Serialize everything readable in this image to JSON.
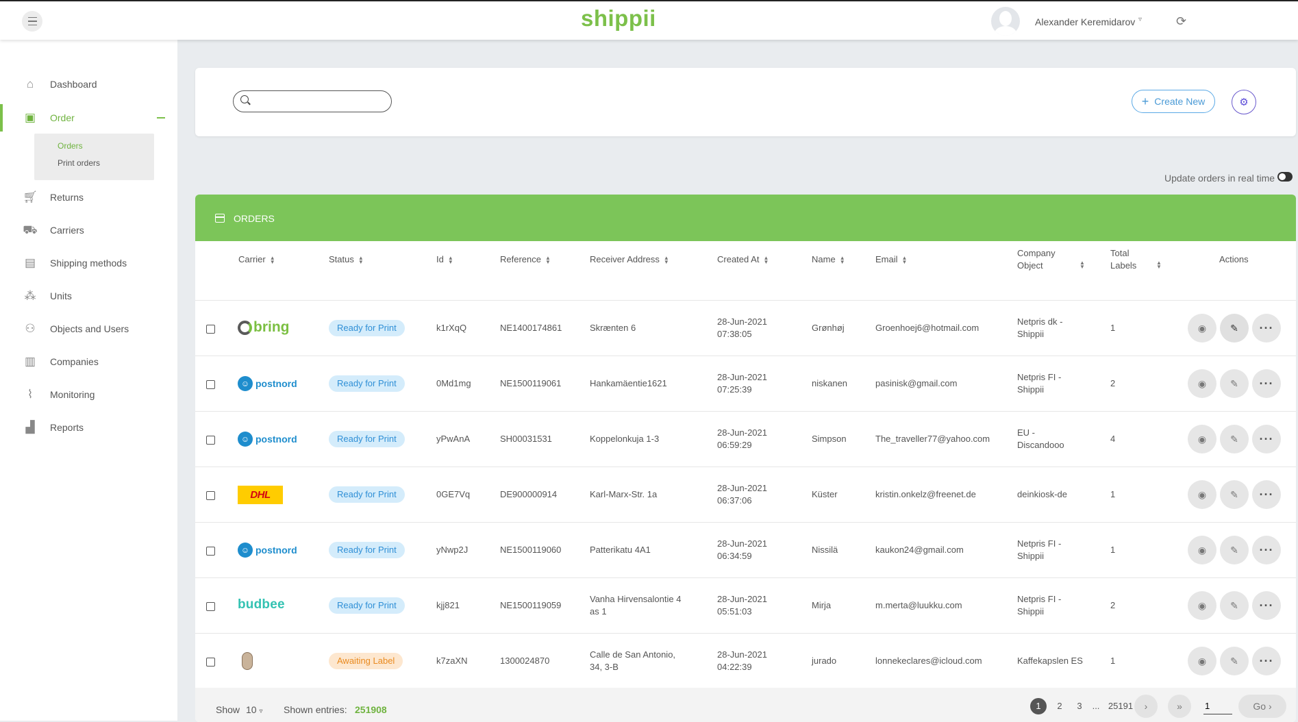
{
  "header": {
    "logo": "shippii",
    "user_name": "Alexander Keremidarov",
    "caret": "▿",
    "refresh_icon": "refresh-icon"
  },
  "sidebar": {
    "items": [
      {
        "label": "Dashboard",
        "icon": "home-icon"
      },
      {
        "label": "Order",
        "icon": "box-icon"
      },
      {
        "label": "Returns",
        "icon": "cart-icon"
      },
      {
        "label": "Carriers",
        "icon": "truck-icon"
      },
      {
        "label": "Shipping methods",
        "icon": "pallet-icon"
      },
      {
        "label": "Units",
        "icon": "network-icon"
      },
      {
        "label": "Objects and Users",
        "icon": "users-icon"
      },
      {
        "label": "Companies",
        "icon": "building-icon"
      },
      {
        "label": "Monitoring",
        "icon": "pulse-icon"
      },
      {
        "label": "Reports",
        "icon": "chart-icon"
      }
    ],
    "submenu": [
      {
        "label": "Orders"
      },
      {
        "label": "Print orders"
      }
    ]
  },
  "toolbar": {
    "search_value": "",
    "create_label": "Create New",
    "realtime_label": "Update orders in real time"
  },
  "orders": {
    "title": "ORDERS",
    "columns": {
      "carrier": "Carrier",
      "status": "Status",
      "id": "Id",
      "reference": "Reference",
      "address": "Receiver Address",
      "created": "Created At",
      "name": "Name",
      "email": "Email",
      "company_1": "Company",
      "company_2": "Object",
      "labels_1": "Total",
      "labels_2": "Labels",
      "actions": "Actions"
    },
    "rows": [
      {
        "carrier": "bring",
        "status": "Ready for Print",
        "id": "k1rXqQ",
        "reference": "NE1400174861",
        "address_1": "Skrænten 6",
        "address_2": "",
        "date": "28-Jun-2021",
        "time": "07:38:05",
        "name": "Grønhøj",
        "email": "Groenhoej6@hotmail.com",
        "company_1": "Netpris dk -",
        "company_2": "Shippii",
        "labels": "1"
      },
      {
        "carrier": "postnord",
        "status": "Ready for Print",
        "id": "0Md1mg",
        "reference": "NE1500119061",
        "address_1": "Hankamäentie1621",
        "address_2": "",
        "date": "28-Jun-2021",
        "time": "07:25:39",
        "name": "niskanen",
        "email": "pasinisk@gmail.com",
        "company_1": "Netpris FI -",
        "company_2": "Shippii",
        "labels": "2"
      },
      {
        "carrier": "postnord",
        "status": "Ready for Print",
        "id": "yPwAnA",
        "reference": "SH00031531",
        "address_1": "Koppelonkuja 1-3",
        "address_2": "",
        "date": "28-Jun-2021",
        "time": "06:59:29",
        "name": "Simpson",
        "email": "The_traveller77@yahoo.com",
        "company_1": "EU -",
        "company_2": "Discandooo",
        "labels": "4"
      },
      {
        "carrier": "DHL",
        "status": "Ready for Print",
        "id": "0GE7Vq",
        "reference": "DE900000914",
        "address_1": "Karl-Marx-Str. 1a",
        "address_2": "",
        "date": "28-Jun-2021",
        "time": "06:37:06",
        "name": "Küster",
        "email": "kristin.onkelz@freenet.de",
        "company_1": "deinkiosk-de",
        "company_2": "",
        "labels": "1"
      },
      {
        "carrier": "postnord",
        "status": "Ready for Print",
        "id": "yNwp2J",
        "reference": "NE1500119060",
        "address_1": "Patterikatu 4A1",
        "address_2": "",
        "date": "28-Jun-2021",
        "time": "06:34:59",
        "name": "Nissilä",
        "email": "kaukon24@gmail.com",
        "company_1": "Netpris FI -",
        "company_2": "Shippii",
        "labels": "1"
      },
      {
        "carrier": "budbee",
        "status": "Ready for Print",
        "id": "kjj821",
        "reference": "NE1500119059",
        "address_1": "Vanha Hirvensalontie 4",
        "address_2": "as 1",
        "date": "28-Jun-2021",
        "time": "05:51:03",
        "name": "Mirja",
        "email": "m.merta@luukku.com",
        "company_1": "Netpris FI -",
        "company_2": "Shippii",
        "labels": "2"
      },
      {
        "carrier": "kaffekapslen",
        "status": "Awaiting Label",
        "id": "k7zaXN",
        "reference": "1300024870",
        "address_1": "Calle de San Antonio,",
        "address_2": "34, 3-B",
        "date": "28-Jun-2021",
        "time": "04:22:39",
        "name": "jurado",
        "email": "lonnekeclares@icloud.com",
        "company_1": "Kaffekapslen ES",
        "company_2": "",
        "labels": "1"
      }
    ]
  },
  "footer": {
    "show_label": "Show",
    "show_value": "10",
    "shown_entries_label": "Shown entries:",
    "shown_entries_value": "251908",
    "pages": [
      "1",
      "2",
      "3"
    ],
    "ellipsis": "...",
    "last_page": "25191",
    "goto_value": "1",
    "go_label": "Go"
  },
  "colors": {
    "brand_green": "#7cc559",
    "status_ready_bg": "#d4ecfb",
    "status_awaiting_bg": "#fde7cf"
  }
}
